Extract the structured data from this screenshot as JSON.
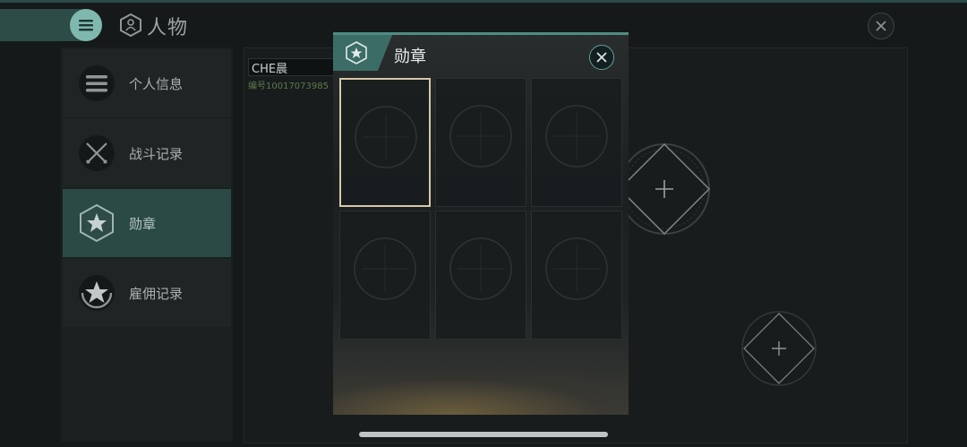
{
  "header": {
    "title": "人物",
    "menu_icon": "list-icon",
    "title_icon": "cube-person-icon",
    "close_icon": "close-icon"
  },
  "sidebar": {
    "items": [
      {
        "label": "个人信息",
        "icon": "list-lines-icon",
        "active": false
      },
      {
        "label": "战斗记录",
        "icon": "crossed-swords-icon",
        "active": false
      },
      {
        "label": "勋章",
        "icon": "star-hexagon-icon",
        "active": true
      },
      {
        "label": "雇佣记录",
        "icon": "star-laurel-icon",
        "active": false
      }
    ]
  },
  "profile": {
    "name": "CHE晨",
    "id_line": "编号10017073985"
  },
  "modal": {
    "title": "勋章",
    "tab_icon": "star-hexagon-icon",
    "close_icon": "close-icon",
    "slots": [
      {
        "selected": true
      },
      {
        "selected": false
      },
      {
        "selected": false
      },
      {
        "selected": false
      },
      {
        "selected": false
      },
      {
        "selected": false
      }
    ]
  },
  "colors": {
    "accent": "#2b4a46",
    "accent_light": "#7fb8ae",
    "selected_border": "#d8c7a8",
    "id_text": "#5d7a4c"
  }
}
